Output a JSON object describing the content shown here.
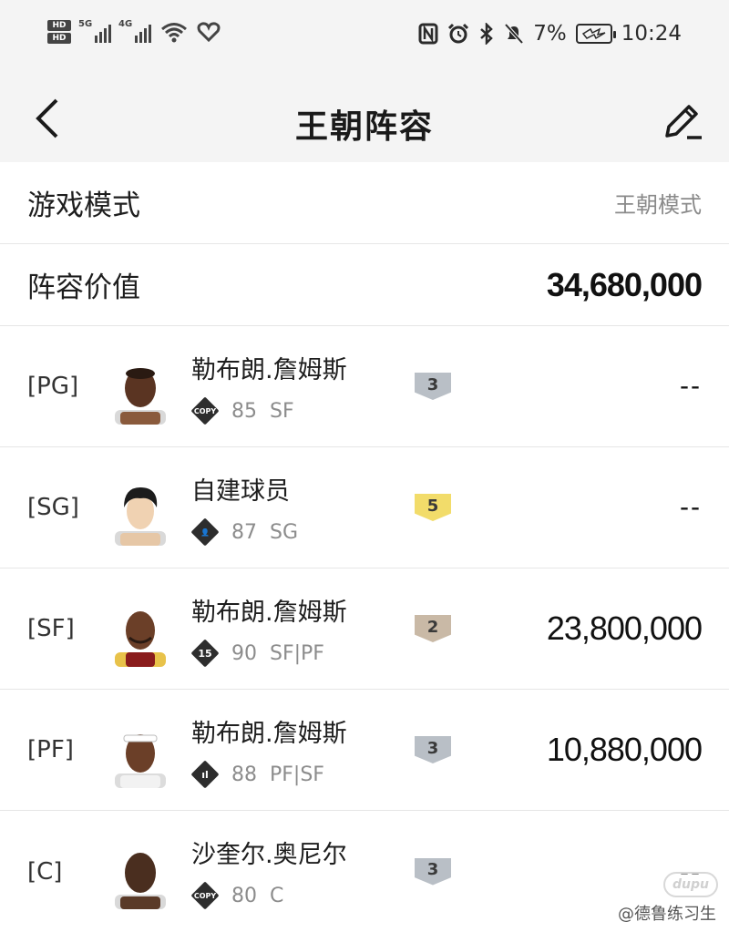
{
  "status_bar": {
    "network_left": [
      "5G",
      "4G"
    ],
    "hd_labels": [
      "HD",
      "HD"
    ],
    "battery": "7%",
    "time": "10:24"
  },
  "header": {
    "title": "王朝阵容",
    "back_icon": "chevron-left-icon",
    "edit_icon": "edit-pen-icon"
  },
  "info": {
    "mode_label": "游戏模式",
    "mode_value": "王朝模式",
    "value_label": "阵容价值",
    "value_amount": "34,680,000"
  },
  "players": [
    {
      "pos": "[PG]",
      "name": "勒布朗.詹姆斯",
      "badge_text": "COPY",
      "rating": "85",
      "positions": "SF",
      "rank": "3",
      "rank_color": "#b9bfc6",
      "rank_text_color": "#3a3a3a",
      "salary": "--"
    },
    {
      "pos": "[SG]",
      "name": "自建球员",
      "badge_text": "👤",
      "rating": "87",
      "positions": "SG",
      "rank": "5",
      "rank_color": "#f2dc6a",
      "rank_text_color": "#3a3a3a",
      "salary": "--"
    },
    {
      "pos": "[SF]",
      "name": "勒布朗.詹姆斯",
      "badge_text": "15",
      "rating": "90",
      "positions": "SF|PF",
      "rank": "2",
      "rank_color": "#c9b9a6",
      "rank_text_color": "#3a3a3a",
      "salary": "23,800,000"
    },
    {
      "pos": "[PF]",
      "name": "勒布朗.詹姆斯",
      "badge_text": "ıl",
      "rating": "88",
      "positions": "PF|SF",
      "rank": "3",
      "rank_color": "#b9bfc6",
      "rank_text_color": "#3a3a3a",
      "salary": "10,880,000"
    },
    {
      "pos": "[C]",
      "name": "沙奎尔.奥尼尔",
      "badge_text": "COPY",
      "rating": "80",
      "positions": "C",
      "rank": "3",
      "rank_color": "#b9bfc6",
      "rank_text_color": "#3a3a3a",
      "salary": "--"
    }
  ],
  "watermark": {
    "logo": "dupu",
    "text": "@德鲁练习生"
  }
}
